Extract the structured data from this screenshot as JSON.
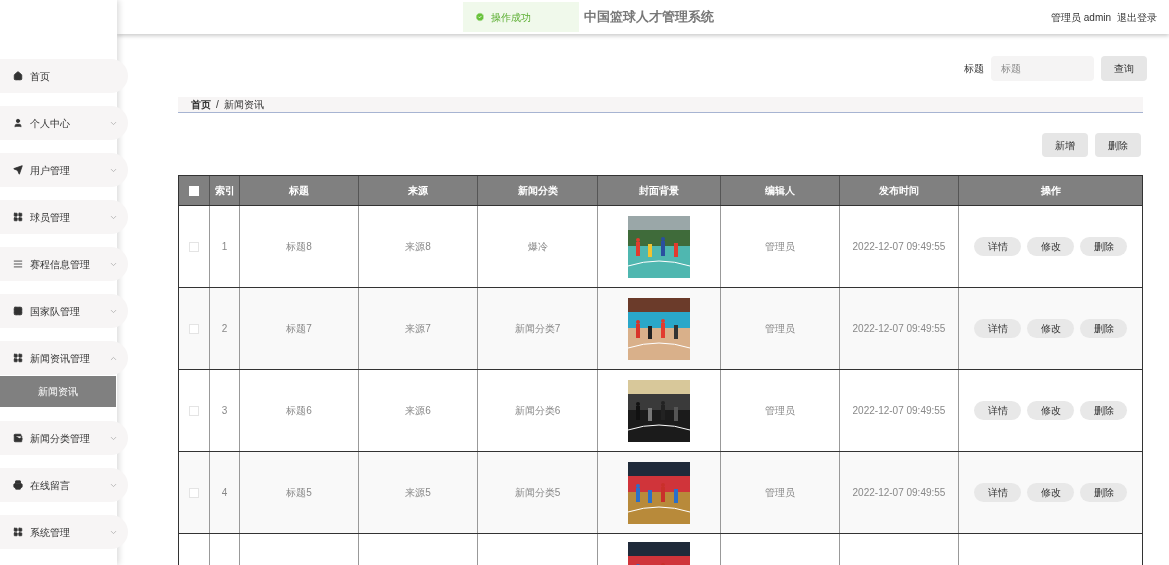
{
  "header": {
    "title": "中国篮球人才管理系统",
    "user": "管理员 admin",
    "logout": "退出登录"
  },
  "toast": {
    "message": "操作成功"
  },
  "sidebar": {
    "items": [
      {
        "label": "首页"
      },
      {
        "label": "个人中心",
        "expanded": false
      },
      {
        "label": "用户管理",
        "expanded": false
      },
      {
        "label": "球员管理",
        "expanded": false
      },
      {
        "label": "赛程信息管理",
        "expanded": false
      },
      {
        "label": "国家队管理",
        "expanded": false
      },
      {
        "label": "新闻资讯管理",
        "expanded": true,
        "children": [
          {
            "label": "新闻资讯",
            "selected": true
          }
        ]
      },
      {
        "label": "新闻分类管理",
        "expanded": false
      },
      {
        "label": "在线留言",
        "expanded": false
      },
      {
        "label": "系统管理",
        "expanded": false
      }
    ]
  },
  "search": {
    "label": "标题",
    "placeholder": "标题",
    "button": "查询"
  },
  "breadcrumb": [
    "首页",
    "/",
    "新闻资讯"
  ],
  "actions": [
    "新增",
    "删除"
  ],
  "table": {
    "columns": [
      "索引",
      "标题",
      "来源",
      "新闻分类",
      "封面背景",
      "编辑人",
      "发布时间",
      "操作"
    ],
    "select_all": {
      "checked": false
    },
    "rows": [
      {
        "checked": false,
        "cells": [
          "1",
          "标题8",
          "来源8",
          "爆冷",
          "管理员",
          "2022-12-07 09:49:55"
        ],
        "buttons": [
          "详情",
          "修改",
          "删除"
        ]
      },
      {
        "checked": false,
        "cells": [
          "2",
          "标题7",
          "来源7",
          "新闻分类7",
          "管理员",
          "2022-12-07 09:49:55"
        ],
        "buttons": [
          "详情",
          "修改",
          "删除"
        ]
      },
      {
        "checked": false,
        "cells": [
          "3",
          "标题6",
          "来源6",
          "新闻分类6",
          "管理员",
          "2022-12-07 09:49:55"
        ],
        "buttons": [
          "详情",
          "修改",
          "删除"
        ]
      },
      {
        "checked": false,
        "cells": [
          "4",
          "标题5",
          "来源5",
          "新闻分类5",
          "管理员",
          "2022-12-07 09:49:55"
        ],
        "buttons": [
          "详情",
          "修改",
          "删除"
        ]
      },
      {
        "kind": "partial"
      }
    ]
  }
}
